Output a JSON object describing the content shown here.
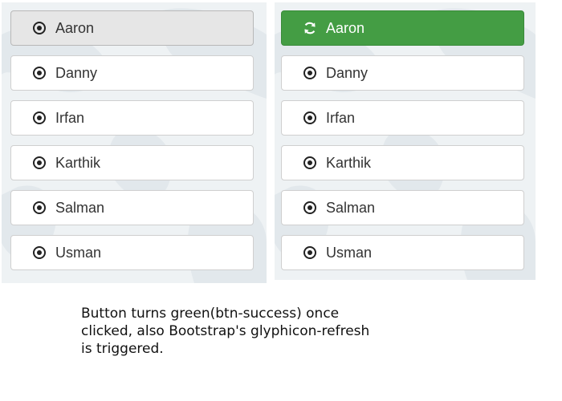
{
  "colors": {
    "panel_bg": "#eef2f4",
    "button_default_bg": "#ffffff",
    "button_active_bg": "#e6e6e6",
    "button_success_bg": "#449d44",
    "button_text": "#333333"
  },
  "left_panel": {
    "buttons": [
      {
        "label": "Aaron",
        "icon": "record-icon",
        "state": "active"
      },
      {
        "label": "Danny",
        "icon": "record-icon",
        "state": "default"
      },
      {
        "label": "Irfan",
        "icon": "record-icon",
        "state": "default"
      },
      {
        "label": "Karthik",
        "icon": "record-icon",
        "state": "default"
      },
      {
        "label": "Salman",
        "icon": "record-icon",
        "state": "default"
      },
      {
        "label": "Usman",
        "icon": "record-icon",
        "state": "default"
      }
    ]
  },
  "right_panel": {
    "buttons": [
      {
        "label": "Aaron",
        "icon": "refresh-icon",
        "state": "success"
      },
      {
        "label": "Danny",
        "icon": "record-icon",
        "state": "default"
      },
      {
        "label": "Irfan",
        "icon": "record-icon",
        "state": "default"
      },
      {
        "label": "Karthik",
        "icon": "record-icon",
        "state": "default"
      },
      {
        "label": "Salman",
        "icon": "record-icon",
        "state": "default"
      },
      {
        "label": "Usman",
        "icon": "record-icon",
        "state": "default"
      }
    ]
  },
  "caption": {
    "line1": "Button turns green(btn-success) once",
    "line2": "clicked, also Bootstrap's glyphicon-refresh",
    "line3": "is triggered."
  }
}
